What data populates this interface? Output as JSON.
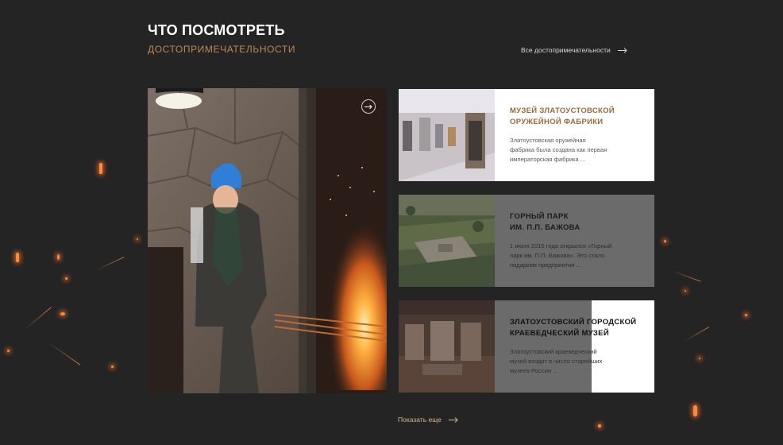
{
  "section": {
    "title": "ЧТО ПОСМОТРЕТЬ",
    "subtitle": "ДОСТОПРИМЕЧАТЕЛЬНОСТИ",
    "all_link": "Все достопримечательности"
  },
  "featured": {
    "image_icon": "forge-photo",
    "arrow_icon": "circle-arrow-icon"
  },
  "cards": [
    {
      "title": "МУЗЕЙ ЗЛАТОУСТОВСКОЙ\nОРУЖЕЙНОЙ ФАБРИКИ",
      "description": "Златоустовская оружейная\nфабрика была создана как первая\nимператорская фабрика ..."
    },
    {
      "title": "ГОРНЫЙ ПАРК\nИМ. П.П. БАЖОВА",
      "description": "1 июня 2015 года открылся «Горный\nпарк им. П.П. Бажова». Это стало\nподарком предприятия ..."
    },
    {
      "title": "ЗЛАТОУСТОВСКИЙ ГОРОДСКОЙ\nКРАЕВЕДЧЕСКИЙ МУЗЕЙ",
      "description": "Златоустовский краеведческий\nмузей входит в число старейших\nмузеев России ..."
    }
  ],
  "show_more": "Показать еще",
  "colors": {
    "background": "#242424",
    "accent": "#b88a5a",
    "link": "#d8b58c"
  }
}
